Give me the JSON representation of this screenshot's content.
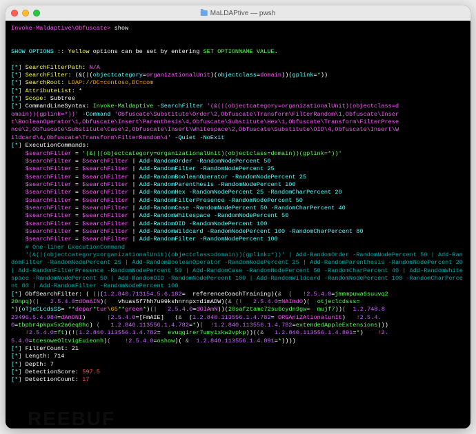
{
  "window": {
    "title": "MaLDAPtive — pwsh"
  },
  "prompt": {
    "path": "Invoke-Maldaptive\\Obfuscate>",
    "cmd": "show"
  },
  "banner": {
    "a": "SHOW OPTIONS",
    "b": " :: ",
    "c": "Yellow",
    "d": " options can be set by entering ",
    "e": "SET OPTIONNAME VALUE",
    "f": "."
  },
  "opts": {
    "sfp": {
      "label": "SearchFilterPath",
      "val": "N/A"
    },
    "sf": {
      "label": "SearchFilter",
      "p1": "(&(|(",
      "p2": "objectcategory",
      "p3": "=",
      "p4": "organizationalUnit",
      "p5": ")(",
      "p6": "objectclass",
      "p7": "=",
      "p8": "domain",
      "p9": "))(",
      "p10": "gplink",
      "p11": "=",
      "p12": "*",
      "p13": "))"
    },
    "sr": {
      "label": "SearchRoot",
      "val": "LDAP://DC=contoso,DC=com"
    },
    "al": {
      "label": "AttributeList",
      "val": "*"
    },
    "sc": {
      "label": "Scope",
      "val": "Subtree"
    }
  },
  "cls": {
    "label": "CommandLineSyntax",
    "inv": "Invoke-Maldaptive",
    "sf_flag": " -SearchFilter ",
    "sf_val_a": "'(&(|(objectcategory=organizationalUnit)(objectclass=d",
    "sf_val_b": "omain))(gplink=*))'",
    "cmd_flag": " -Command ",
    "cmd_val_a": "'Obfuscate\\Substitute\\Order\\2,Obfuscate\\Transform\\FilterRandom\\1,Obfuscate\\Inser",
    "cmd_val_b": "t\\BooleanOperator\\1,Obfuscate\\Insert\\Parenthesis\\4,Obfuscate\\Substitute\\Hex\\1,Obfuscate\\Transform\\FilterPrese",
    "cmd_val_c": "nce\\2,Obfuscate\\Substitute\\Case\\2,Obfuscate\\Insert\\Whitespace\\2,Obfuscate\\Substitute\\OID\\4,Obfuscate\\Insert\\W",
    "cmd_val_d": "ildcard\\4,Obfuscate\\Transform\\FilterRandom\\4'",
    "tail": " -Quiet -NoExit"
  },
  "exec": {
    "label": "ExecutionCommands",
    "var": "$searchFilter",
    "eq": " = ",
    "init": "'(&(|(objectcategory=organizationalUnit)(objectclass=domain))(gplink=*))'",
    "pipe": " | ",
    "rows": [
      "Add-RandomOrder -RandomNodePercent 50",
      "Add-RandomFilter -RandomNodePercent 25",
      "Add-RandomBooleanOperator -RandomNodePercent 25",
      "Add-RandomParenthesis -RandomNodePercent 100",
      "Add-RandomHex -RandomNodePercent 25 -RandomCharPercent 20",
      "Add-RandomFilterPresence -RandomNodePercent 50",
      "Add-RandomCase -RandomNodePercent 50 -RandomCharPercent 40",
      "Add-RandomWhitespace -RandomNodePercent 50",
      "Add-RandomOID -RandomNodePercent 100",
      "Add-RandomWildcard -RandomNodePercent 100 -RandomCharPercent 80",
      "Add-RandomFilter -RandomNodePercent 100"
    ],
    "oneliner_label": "# One-liner ExecutionCommand",
    "oneliner": "'(&(|(objectcategory=organizationalUnit)(objectclass=domain))(gplink=*))' | Add-RandomOrder -RandomNodePercent 50 | Add-RandomFilter -RandomNodePercent 25 | Add-RandomBooleanOperator -RandomNodePercent 25 | Add-RandomParenthesis -RandomNodePercent 20 | Add-RandomFilterPresence -RandomNodePercent 50 | Add-RandomCase -RandomNodePercent 50 -RandomCharPercent 40 | Add-RandomWhitespace -RandomNodePercent 50 | Add-RandomOID -RandomNodePercent 100 | Add-RandomWildcard -RandomNodePercent 100 -RandomCharPercent 80 | Add-RandomFilter -RandomNodePercent 100"
  },
  "obf": {
    "label": "ObfSearchFilter",
    "tokens": [
      {
        "t": "( ",
        "c": "white"
      },
      {
        "t": "(|",
        "c": "grey"
      },
      {
        "t": "(",
        "c": "white"
      },
      {
        "t": "1.2.840.713154.5.6.182",
        "c": "purple"
      },
      {
        "t": "=  referenceCoachTraining)",
        "c": "white"
      },
      {
        "t": "(",
        "c": "white"
      },
      {
        "t": "&  (",
        "c": "grey"
      },
      {
        "t": "   ",
        "c": "white"
      },
      {
        "t": "!",
        "c": "red"
      },
      {
        "t": "2.5.4.0",
        "c": "purple"
      },
      {
        "t": "=",
        "c": "white"
      },
      {
        "t": "jmmmpuwa6suuvq2\n20npq",
        "c": "green"
      },
      {
        "t": ")",
        "c": "white"
      },
      {
        "t": "(|   ",
        "c": "grey"
      },
      {
        "t": "2.5.4.0",
        "c": "purple"
      },
      {
        "t": "=",
        "c": "white"
      },
      {
        "t": "dOmAIN",
        "c": "magenta"
      },
      {
        "t": ")",
        "c": "white"
      },
      {
        "t": "(   ",
        "c": "grey"
      },
      {
        "t": "vhuas5f7hh7u99kshnrnpx=dimADW",
        "c": "white"
      },
      {
        "t": ")",
        "c": "white"
      },
      {
        "t": "(",
        "c": "white"
      },
      {
        "t": "&",
        "c": "grey"
      },
      {
        "t": " ",
        "c": "white"
      },
      {
        "t": "(!   ",
        "c": "grey"
      },
      {
        "t": "2.5.4.0",
        "c": "purple"
      },
      {
        "t": "=",
        "c": "white"
      },
      {
        "t": "NAImdO",
        "c": "magenta"
      },
      {
        "t": ")",
        "c": "white"
      },
      {
        "t": "(  ",
        "c": "grey"
      },
      {
        "t": "otjeclcdsss=\n*",
        "c": "green"
      },
      {
        "t": ")",
        "c": "white"
      },
      {
        "t": "(",
        "c": "white"
      },
      {
        "t": "oTjeCLcdsSS",
        "c": "cyan"
      },
      {
        "t": "= ",
        "c": "white"
      },
      {
        "t": "*",
        "c": "green"
      },
      {
        "t": "*",
        "c": "green"
      },
      {
        "t": "depar",
        "c": "magenta"
      },
      {
        "t": "*",
        "c": "green"
      },
      {
        "t": "tur",
        "c": "magenta"
      },
      {
        "t": "\\65",
        "c": "orange"
      },
      {
        "t": "*",
        "c": "green"
      },
      {
        "t": "*",
        "c": "green"
      },
      {
        "t": "green",
        "c": "magenta"
      },
      {
        "t": "*",
        "c": "green"
      },
      {
        "t": ")",
        "c": "white"
      },
      {
        "t": "(|   ",
        "c": "grey"
      },
      {
        "t": "2.5.4.0",
        "c": "purple"
      },
      {
        "t": "=",
        "c": "white"
      },
      {
        "t": "dOIAmN",
        "c": "magenta"
      },
      {
        "t": ")",
        "c": "white"
      },
      {
        "t": ")",
        "c": "white"
      },
      {
        "t": "(",
        "c": "white"
      },
      {
        "t": "20safztamc72su6cydn9gw=  mujf7",
        "c": "green"
      },
      {
        "t": ")",
        "c": "white"
      },
      {
        "t": ")",
        "c": "white"
      },
      {
        "t": "(  ",
        "c": "grey"
      },
      {
        "t": "1.2.748.8\n23496.5.4.984",
        "c": "purple"
      },
      {
        "t": "=",
        "c": "white"
      },
      {
        "t": "dAmONI",
        "c": "magenta"
      },
      {
        "t": ")",
        "c": "white"
      },
      {
        "t": "      ",
        "c": "white"
      },
      {
        "t": "|",
        "c": "grey"
      },
      {
        "t": "2.5.4.0",
        "c": "purple"
      },
      {
        "t": "=",
        "c": "white"
      },
      {
        "t": "[FmAIE]",
        "c": "white"
      },
      {
        "t": "   (",
        "c": "white"
      },
      {
        "t": "&  ",
        "c": "grey"
      },
      {
        "t": "(",
        "c": "white"
      },
      {
        "t": "1.2.840.113556.1.4.782",
        "c": "purple"
      },
      {
        "t": "= ",
        "c": "white"
      },
      {
        "t": "ORGAniZAtionalunIt",
        "c": "magenta"
      },
      {
        "t": ")",
        "c": "white"
      },
      {
        "t": "   ",
        "c": "white"
      },
      {
        "t": "!",
        "c": "red"
      },
      {
        "t": "2.5.4.\n0",
        "c": "purple"
      },
      {
        "t": "=",
        "c": "white"
      },
      {
        "t": "tbpbr4pkpx5x2a6eq8hc",
        "c": "green"
      },
      {
        "t": ")",
        "c": "white"
      },
      {
        "t": " (   ",
        "c": "grey"
      },
      {
        "t": "1.2.840.113556.1.4.782",
        "c": "purple"
      },
      {
        "t": "=",
        "c": "white"
      },
      {
        "t": "*",
        "c": "green"
      },
      {
        "t": ")",
        "c": "white"
      },
      {
        "t": "(  ",
        "c": "grey"
      },
      {
        "t": "!",
        "c": "red"
      },
      {
        "t": "1.2.840.113556.1.4.782",
        "c": "purple"
      },
      {
        "t": "=",
        "c": "white"
      },
      {
        "t": "extendedAppleExtensions",
        "c": "green"
      },
      {
        "t": ")",
        "c": "white"
      },
      {
        "t": ")",
        "c": "white"
      },
      {
        "t": ")",
        "c": "white"
      },
      {
        "t": "\n    ",
        "c": "white"
      },
      {
        "t": "!",
        "c": "red"
      },
      {
        "t": "2.5.4.0",
        "c": "purple"
      },
      {
        "t": "=",
        "c": "white"
      },
      {
        "t": "ft",
        "c": "green"
      },
      {
        "t": ")",
        "c": "white"
      },
      {
        "t": "(!",
        "c": "white"
      },
      {
        "t": "(",
        "c": "grey"
      },
      {
        "t": "1.2.840.113556.1.4.782",
        "c": "purple"
      },
      {
        "t": "=  ",
        "c": "white"
      },
      {
        "t": "evuqgirer7umy1xkw2vpkp",
        "c": "green"
      },
      {
        "t": ")",
        "c": "white"
      },
      {
        "t": ")",
        "c": "white"
      },
      {
        "t": "(",
        "c": "white"
      },
      {
        "t": "(&   ",
        "c": "grey"
      },
      {
        "t": "1.2.840.113556.1.4.891",
        "c": "purple"
      },
      {
        "t": "=",
        "c": "white"
      },
      {
        "t": "*",
        "c": "green"
      },
      {
        "t": ")",
        "c": "white"
      },
      {
        "t": "    ",
        "c": "white"
      },
      {
        "t": "!",
        "c": "red"
      },
      {
        "t": "2.\n5.4.0",
        "c": "purple"
      },
      {
        "t": "=",
        "c": "white"
      },
      {
        "t": "tcesoweOltvigEuieonh",
        "c": "green"
      },
      {
        "t": ")",
        "c": "white"
      },
      {
        "t": "(    ",
        "c": "grey"
      },
      {
        "t": "!",
        "c": "red"
      },
      {
        "t": "2.5.4.0",
        "c": "purple"
      },
      {
        "t": "=",
        "c": "white"
      },
      {
        "t": "oshow",
        "c": "green"
      },
      {
        "t": ")",
        "c": "white"
      },
      {
        "t": "(",
        "c": "white"
      },
      {
        "t": " &  ",
        "c": "grey"
      },
      {
        "t": "1.2.840.113556.1.4.891",
        "c": "purple"
      },
      {
        "t": "=",
        "c": "white"
      },
      {
        "t": "*",
        "c": "green"
      },
      {
        "t": ")",
        "c": "white"
      },
      {
        "t": ")",
        "c": "white"
      },
      {
        "t": ")",
        "c": "white"
      },
      {
        "t": ")",
        "c": "white"
      }
    ]
  },
  "stats": {
    "fc": {
      "label": "FilterCount",
      "val": "21"
    },
    "len": {
      "label": "Length",
      "val": "714"
    },
    "dep": {
      "label": "Depth",
      "val": "7"
    },
    "ds": {
      "label": "DetectionScore",
      "val": "597.5"
    },
    "dc": {
      "label": "DetectionCount",
      "val": "17"
    }
  },
  "bullet": "[*] ",
  "colon": ": ",
  "watermark": "REEBUF"
}
